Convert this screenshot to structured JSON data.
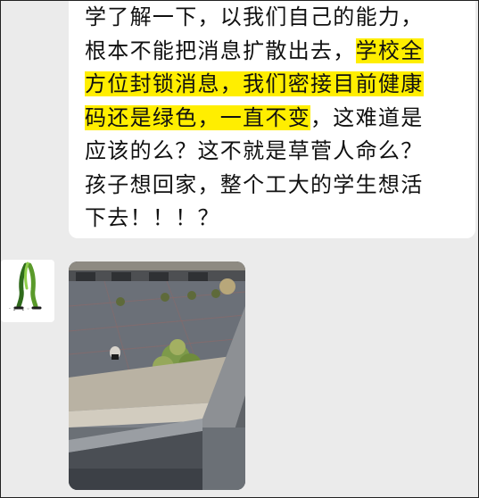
{
  "message": {
    "lines": [
      {
        "parts": [
          {
            "text": "学了解一下，以我们自己的能力，",
            "highlight": false
          }
        ]
      },
      {
        "parts": [
          {
            "text": "根本不能把消息扩散出去，",
            "highlight": false
          },
          {
            "text": "学校全",
            "highlight": true
          }
        ]
      },
      {
        "parts": [
          {
            "text": "方位封锁消息，我们密接目前健康",
            "highlight": true
          }
        ]
      },
      {
        "parts": [
          {
            "text": "码还是绿色，一直不变",
            "highlight": true
          },
          {
            "text": "，这难道是",
            "highlight": false
          }
        ]
      },
      {
        "parts": [
          {
            "text": "应该的么？这不就是草菅人命么？",
            "highlight": false
          }
        ]
      },
      {
        "parts": [
          {
            "text": "孩子想回家，整个工大的学生想活",
            "highlight": false
          }
        ]
      },
      {
        "parts": [
          {
            "text": "下去！！！？",
            "highlight": false
          }
        ]
      }
    ],
    "highlight_color": "#ffee00"
  },
  "avatar": {
    "icon": "green-figure-avatar-icon",
    "caption": "· ɪ · ɪ ◦ ·"
  },
  "photo": {
    "subject": "courtyard-seen-from-window"
  }
}
